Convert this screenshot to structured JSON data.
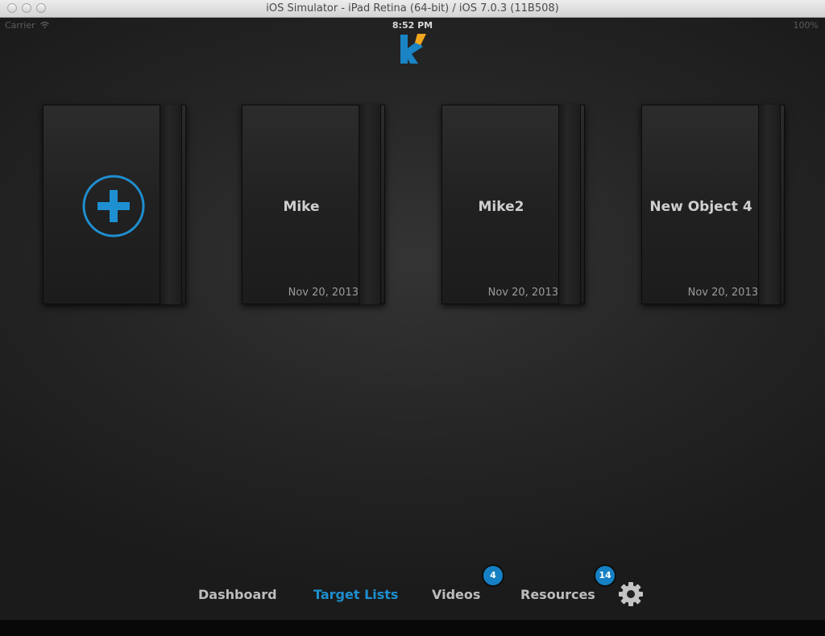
{
  "window": {
    "title": "iOS Simulator - iPad Retina (64-bit) / iOS 7.0.3 (11B508)"
  },
  "status_bar": {
    "carrier": "Carrier",
    "time": "8:52 PM",
    "battery": "100%"
  },
  "books": [
    {
      "icon": "add-plus-icon"
    },
    {
      "name": "Mike",
      "date": "Nov 20, 2013"
    },
    {
      "name": "Mike2",
      "date": "Nov 20, 2013"
    },
    {
      "name": "New Object 4",
      "date": "Nov 20, 2013"
    }
  ],
  "nav": {
    "dashboard": "Dashboard",
    "target_lists": "Target Lists",
    "videos": "Videos",
    "videos_badge": "4",
    "resources": "Resources",
    "resources_badge": "14",
    "active": "target_lists"
  },
  "colors": {
    "accent": "#1e8fd0",
    "badge": "#1680c4",
    "logo_blue": "#1a84c5",
    "logo_orange": "#f2a61c"
  }
}
